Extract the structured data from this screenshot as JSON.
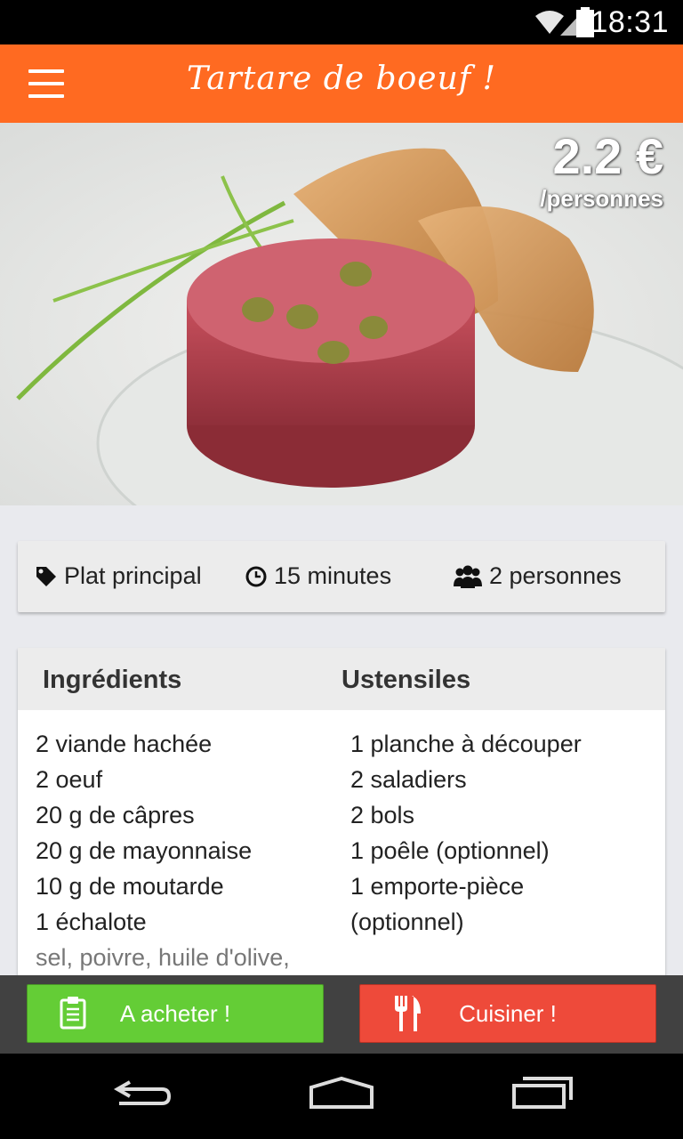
{
  "status_bar": {
    "time": "18:31",
    "icons": [
      "wifi-icon",
      "signal-icon",
      "battery-icon"
    ]
  },
  "app_bar": {
    "title": "Tartare de boeuf !",
    "menu_icon": "hamburger-menu-icon",
    "background": "#ff6a21"
  },
  "hero": {
    "price": "2.2 €",
    "price_unit": "/personnes"
  },
  "info": {
    "category": "Plat principal",
    "duration": "15 minutes",
    "servings": "2 personnes"
  },
  "recipe": {
    "ingredients_title": "Ingrédients",
    "utensils_title": "Ustensiles",
    "ingredients": [
      "2 viande hachée",
      "2 oeuf",
      "20 g de câpres",
      "20 g de mayonnaise",
      "10 g de moutarde",
      "1 échalote",
      "sel, poivre, huile d'olive,"
    ],
    "utensils": [
      "1 planche à découper",
      "2 saladiers",
      "2 bols",
      "1 poêle (optionnel)",
      "1 emporte-pièce",
      "(optionnel)"
    ]
  },
  "actions": {
    "buy_label": "A acheter !",
    "cook_label": "Cuisiner !",
    "buy_color": "#64cd36",
    "cook_color": "#ee4a3a"
  },
  "nav": {
    "icons": [
      "back-icon",
      "home-icon",
      "recents-icon"
    ]
  }
}
